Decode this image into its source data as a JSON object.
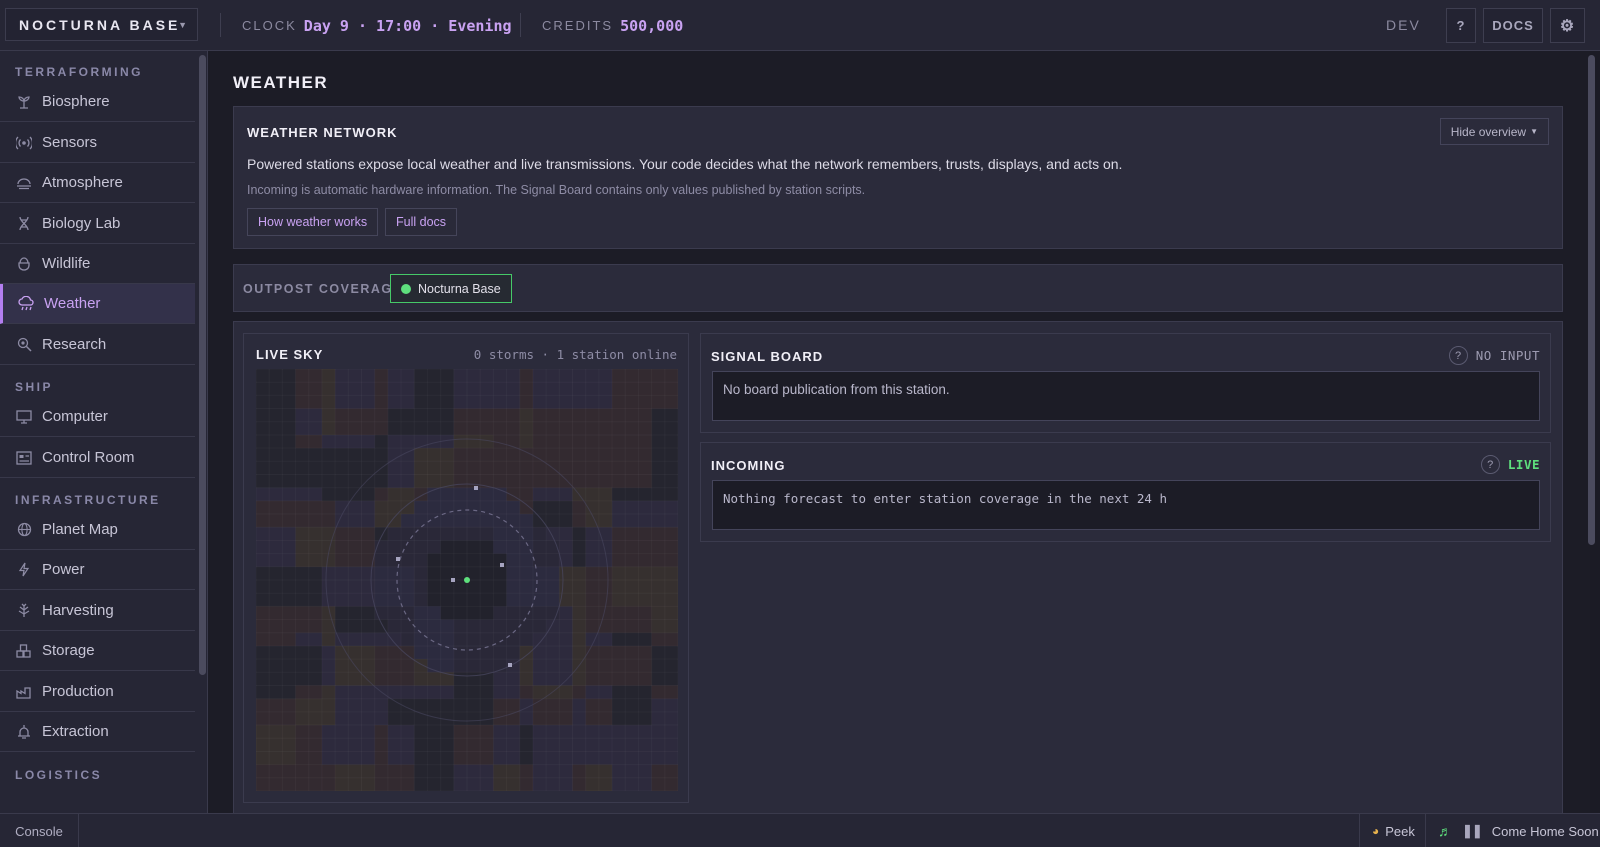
{
  "topbar": {
    "base_name": "NOCTURNA BASE",
    "clock_label": "CLOCK",
    "clock_value": "Day 9 · 17:00 · Evening",
    "credits_label": "CREDITS",
    "credits_value": "500,000",
    "dev_label": "DEV",
    "help_label": "?",
    "docs_label": "DOCS",
    "settings_icon": "gear-icon"
  },
  "sidebar": {
    "sections": [
      {
        "title": "TERRAFORMING",
        "items": [
          {
            "label": "Biosphere",
            "icon": "sprout-icon"
          },
          {
            "label": "Sensors",
            "icon": "broadcast-icon"
          },
          {
            "label": "Atmosphere",
            "icon": "atmosphere-icon"
          },
          {
            "label": "Biology Lab",
            "icon": "dna-icon"
          },
          {
            "label": "Wildlife",
            "icon": "animal-icon"
          },
          {
            "label": "Weather",
            "icon": "cloud-rain-icon",
            "active": true
          },
          {
            "label": "Research",
            "icon": "search-flask-icon"
          }
        ]
      },
      {
        "title": "SHIP",
        "items": [
          {
            "label": "Computer",
            "icon": "monitor-icon"
          },
          {
            "label": "Control Room",
            "icon": "control-panel-icon"
          }
        ]
      },
      {
        "title": "INFRASTRUCTURE",
        "items": [
          {
            "label": "Planet Map",
            "icon": "globe-icon"
          },
          {
            "label": "Power",
            "icon": "lightning-icon"
          },
          {
            "label": "Harvesting",
            "icon": "harvest-icon"
          },
          {
            "label": "Storage",
            "icon": "boxes-icon"
          },
          {
            "label": "Production",
            "icon": "factory-icon"
          },
          {
            "label": "Extraction",
            "icon": "drill-icon"
          }
        ]
      },
      {
        "title": "LOGISTICS",
        "items": []
      }
    ]
  },
  "page": {
    "title": "WEATHER"
  },
  "overview": {
    "title": "WEATHER NETWORK",
    "hide_label": "Hide overview",
    "text_primary": "Powered stations expose local weather and live transmissions. Your code decides what the network remembers, trusts, displays, and acts on.",
    "text_secondary": "Incoming is automatic hardware information. The Signal Board contains only values published by station scripts.",
    "button_how": "How weather works",
    "button_docs": "Full docs"
  },
  "coverage": {
    "label": "OUTPOST COVERAGE",
    "chip_label": "Nocturna Base",
    "chip_color": "#5ee07d"
  },
  "live_sky": {
    "title": "LIVE SKY",
    "status": "0 storms · 1 station online"
  },
  "signal_board": {
    "title": "SIGNAL BOARD",
    "status": "NO INPUT",
    "help": "?",
    "message": "No board publication from this station."
  },
  "incoming": {
    "title": "INCOMING",
    "status": "LIVE",
    "status_color": "#5ee07d",
    "help": "?",
    "message": "Nothing forecast to enter station coverage in the next 24 h"
  },
  "bottombar": {
    "console_label": "Console",
    "peek_label": "Peek",
    "track_label": "Come Home Soon"
  }
}
